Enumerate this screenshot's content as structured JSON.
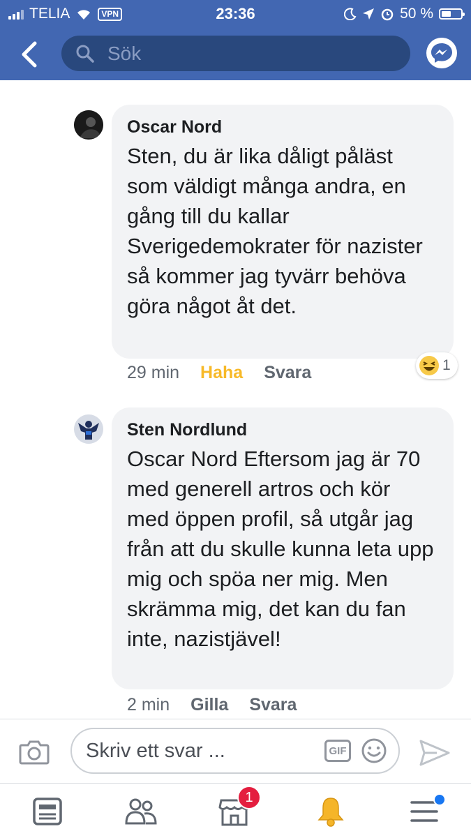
{
  "status_bar": {
    "carrier": "TELIA",
    "vpn": "VPN",
    "time": "23:36",
    "battery": "50 %"
  },
  "header": {
    "search_placeholder": "Sök",
    "back_icon": "chevron-left-icon",
    "messenger_icon": "messenger-icon",
    "color": "#4267b2"
  },
  "comments": [
    {
      "author": "Oscar Nord",
      "text": "Sten, du är lika dåligt påläst som väldigt många andra, en gång till du kallar Sverigedemokrater för nazister så kommer jag tyvärr behöva göra något åt det.",
      "time": "29 min",
      "reaction_action": "Haha",
      "reply": "Svara",
      "reaction_count": "1",
      "reaction_icon": "laughing-emoji-icon"
    },
    {
      "author": "Sten Nordlund",
      "text": "Oscar Nord Eftersom jag är 70 med generell artros och kör med öppen profil, så utgår jag från att du skulle kunna leta upp mig och spöa ner mig. Men skrämma mig, det kan du fan inte, nazistjävel!",
      "time": "2 min",
      "like": "Gilla",
      "reply": "Svara"
    }
  ],
  "composer": {
    "placeholder": "Skriv ett svar ...",
    "gif": "GIF"
  },
  "tabbar": {
    "marketplace_badge": "1",
    "badge_color": "#e41e3f"
  }
}
